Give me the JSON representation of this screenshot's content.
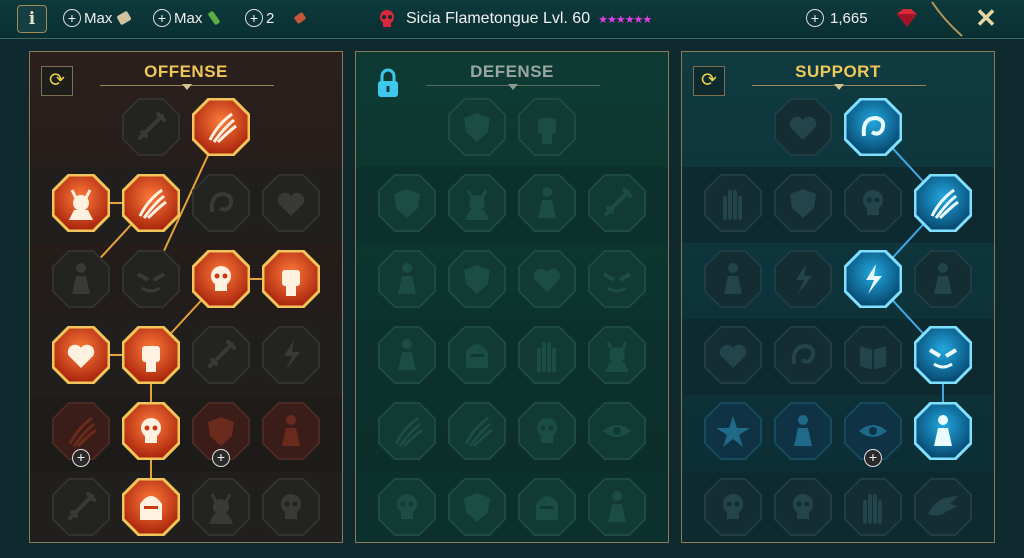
{
  "topbar": {
    "resources": [
      {
        "value": "Max",
        "icon": "scroll-icon"
      },
      {
        "value": "Max",
        "icon": "potion-icon"
      },
      {
        "value": "2",
        "icon": "ticket-icon"
      }
    ],
    "champion": {
      "name": "Sicia Flametongue Lvl. 60",
      "stars": "★★★★★★"
    },
    "gems": "1,665"
  },
  "panels": {
    "offense": {
      "title": "OFFENSE"
    },
    "defense": {
      "title": "DEFENSE"
    },
    "support": {
      "title": "SUPPORT"
    }
  },
  "colors": {
    "offense": "#ff6a2a",
    "support": "#3fd0ff",
    "gold": "#e8b84a"
  }
}
